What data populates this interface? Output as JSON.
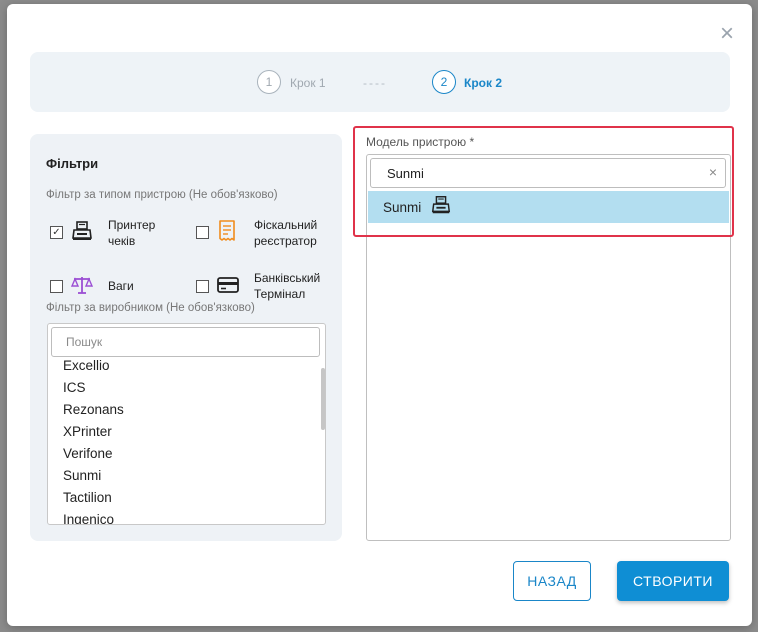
{
  "stepper": {
    "step1_number": "1",
    "step1_label": "Крок 1",
    "separator": "----",
    "step2_number": "2",
    "step2_label": "Крок 2"
  },
  "filters": {
    "title": "Фільтри",
    "type_label": "Фільтр за типом пристрою (Не обов'язково)",
    "types": [
      {
        "label_line1": "Принтер",
        "label_line2": "чеків",
        "checked": true,
        "icon": "receipt-printer-icon"
      },
      {
        "label_line1": "Фіскальний",
        "label_line2": "реєстратор",
        "checked": false,
        "icon": "fiscal-receipt-icon"
      },
      {
        "label_line1": "Ваги",
        "label_line2": "",
        "checked": false,
        "icon": "scales-icon"
      },
      {
        "label_line1": "Банківський",
        "label_line2": "Термінал",
        "checked": false,
        "icon": "bank-card-icon"
      }
    ],
    "manufacturer_label": "Фільтр за виробником (Не обов'язково)",
    "manufacturer_search_placeholder": "Пошук",
    "manufacturers": [
      "Excellio",
      "ICS",
      "Rezonans",
      "XPrinter",
      "Verifone",
      "Sunmi",
      "Tactilion",
      "Ingenico"
    ]
  },
  "model": {
    "label": "Модель пристрою *",
    "search_value": "Sunmi",
    "clear_symbol": "×",
    "options": [
      "Sunmi"
    ]
  },
  "buttons": {
    "back": "НАЗАД",
    "create": "СТВОРИТИ",
    "close_symbol": "×"
  },
  "colors": {
    "accent": "#0f8ed4",
    "selected_option": "#b3def0",
    "highlight": "#e0334a",
    "fiscal_icon": "#f08c1c",
    "scales_icon": "#9b4fd4"
  }
}
